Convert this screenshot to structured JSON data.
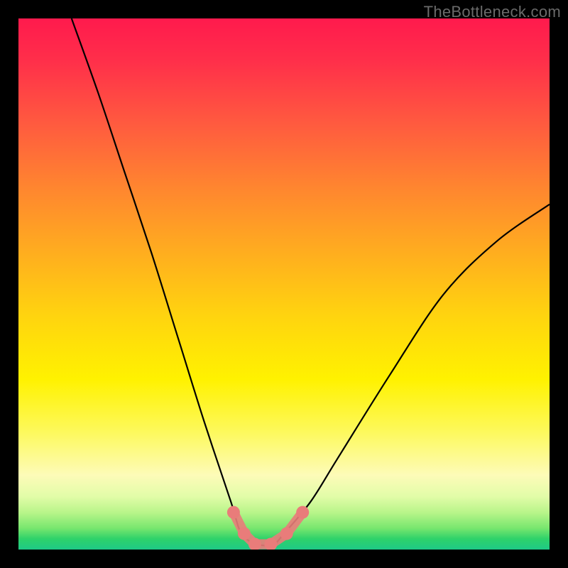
{
  "watermark": "TheBottleneck.com",
  "colors": {
    "frame": "#000000",
    "curve": "#000000",
    "marker": "#e97c7a"
  },
  "chart_data": {
    "type": "line",
    "title": "",
    "xlabel": "",
    "ylabel": "",
    "xlim": [
      0,
      100
    ],
    "ylim": [
      0,
      100
    ],
    "grid": false,
    "legend": false,
    "series": [
      {
        "name": "bottleneck-curve",
        "x": [
          10,
          15,
          20,
          25,
          30,
          35,
          40,
          42,
          45,
          48,
          50,
          55,
          60,
          70,
          80,
          90,
          100
        ],
        "y": [
          100,
          86,
          71,
          56,
          40,
          24,
          9,
          3,
          1,
          1,
          3,
          9,
          17,
          33,
          48,
          58,
          65
        ]
      }
    ],
    "markers": [
      {
        "name": "left-cluster-dot-1",
        "x": 40.5,
        "y": 7
      },
      {
        "name": "left-cluster-dot-2",
        "x": 42.5,
        "y": 3
      },
      {
        "name": "bottom-cluster-dot-1",
        "x": 44.5,
        "y": 1
      },
      {
        "name": "bottom-cluster-dot-2",
        "x": 47.5,
        "y": 1
      },
      {
        "name": "right-cluster-dot-1",
        "x": 50.5,
        "y": 3
      },
      {
        "name": "right-outlier-dot",
        "x": 53.5,
        "y": 7
      }
    ]
  }
}
